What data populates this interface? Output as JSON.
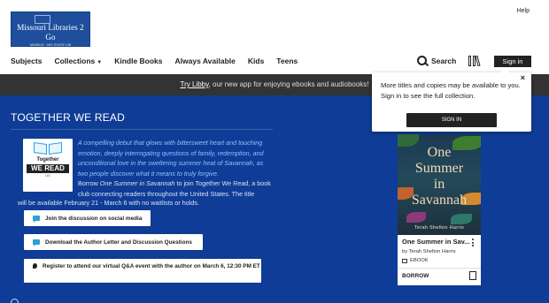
{
  "header": {
    "logo_title": "Missouri Libraries 2 Go",
    "logo_subtitle": "MOBIUS · MO STATE LIB",
    "help": "Help"
  },
  "nav": {
    "items": [
      "Subjects",
      "Collections",
      "Kindle Books",
      "Always Available",
      "Kids",
      "Teens"
    ],
    "search_label": "Search",
    "signin_label": "Sign in"
  },
  "banner": {
    "link_text": "Try Libby",
    "text": ", our new app for enjoying ebooks and audiobooks!"
  },
  "main": {
    "title": "TOGETHER WE READ",
    "badge": {
      "line1": "Together",
      "line2": "WE READ",
      "line3": "US"
    },
    "quote": "A compelling debut that glows with bittersweet heart and touching emotion, deeply interrogating questions of family, redemption, and unconditional love in the sweltering summer heat of Savannah, as two people discover what it means to truly forgive.",
    "borrow_prefix": "Borrow ",
    "borrow_title": "One Summer in Savannah",
    "borrow_suffix": " to join Together We Read, a book club connecting readers throughout the United States. The title",
    "availability": "will be available February 21 - March 6 with no waitlists or holds.",
    "actions": [
      "Join the discussion on social media",
      "Download the Author Letter and Discussion Questions",
      "Register to attend our virtual Q&A event with the author on March 6, 12:30 PM ET"
    ]
  },
  "book": {
    "cover_line1": "One",
    "cover_line2": "Summer",
    "cover_line3": "in",
    "cover_line4": "Savannah",
    "cover_author": "Terah Shelton Harris",
    "title": "One Summer in Sav...",
    "author": "by Terah Shelton Harris",
    "format": "EBOOK",
    "borrow": "BORROW"
  },
  "popup": {
    "message": "More titles and copies may be available to you. Sign in to see the full collection.",
    "button": "SIGN IN",
    "close": "×"
  },
  "colors": {
    "main_blue": "#0f3c96",
    "banner_gray": "#333333",
    "accent_light_blue": "#2a9fd8",
    "dark": "#222222"
  }
}
